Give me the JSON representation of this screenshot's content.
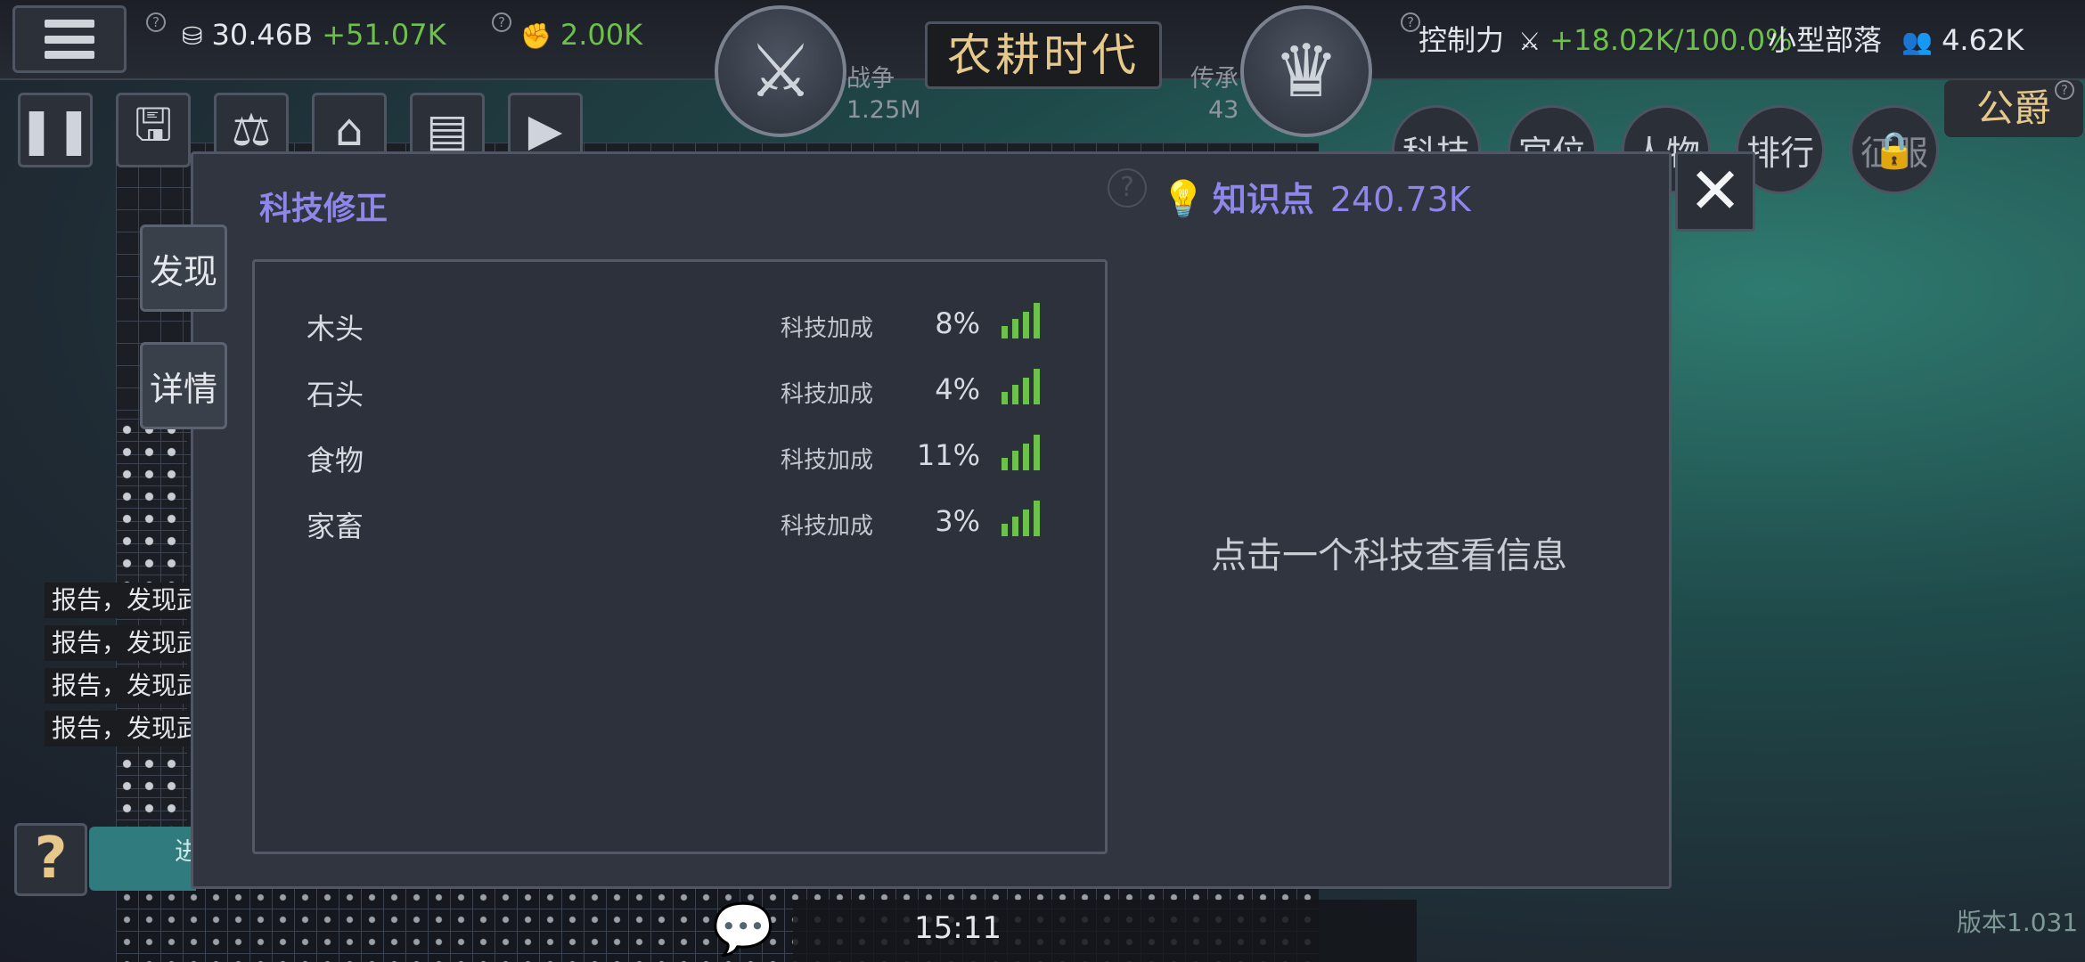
{
  "topbar": {
    "gold": "30.46B",
    "gold_rate": "+51.07K",
    "strength": "2.00K",
    "war_label": "战争",
    "war_value": "1.25M",
    "era": "农耕时代",
    "heritage_label": "传承",
    "heritage_value": "43",
    "control_label": "控制力",
    "control_change": "+18.02K",
    "control_pct": "/100.0%",
    "tribe": "小型部落",
    "population": "4.62K",
    "rank": "公爵"
  },
  "nav_pills": [
    "科技",
    "官位",
    "人物",
    "排行",
    "征服"
  ],
  "side_tabs": {
    "discover": "发现",
    "details": "详情"
  },
  "reports": [
    "报告，发现武",
    "报告，发现武",
    "报告，发现武",
    "报告，发现武"
  ],
  "help_label": "?",
  "teal_bar_text": "进",
  "modal": {
    "title": "科技修正",
    "knowledge_label": "知识点",
    "knowledge_value": "240.73K",
    "hint": "点击一个科技查看信息",
    "rows": [
      {
        "name": "木头",
        "bonus_label": "科技加成",
        "percent": "8%"
      },
      {
        "name": "石头",
        "bonus_label": "科技加成",
        "percent": "4%"
      },
      {
        "name": "食物",
        "bonus_label": "科技加成",
        "percent": "11%"
      },
      {
        "name": "家畜",
        "bonus_label": "科技加成",
        "percent": "3%"
      }
    ]
  },
  "close_label": "✕",
  "clock": "15:11",
  "version": "版本1.031",
  "colors": {
    "accent_purple": "#8f86ea",
    "positive_green": "#6cc14a",
    "gold_text": "#e6c98a"
  }
}
